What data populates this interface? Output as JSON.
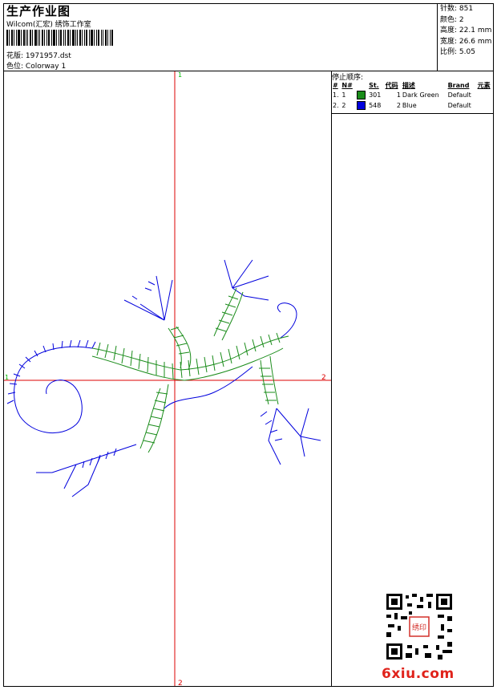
{
  "header": {
    "title": "生产作业图",
    "company": "Wilcom(汇宏) 绣饰工作室",
    "design_label": "花版:",
    "design_value": "1971957.dst",
    "colorway_label": "色位:",
    "colorway_value": "Colorway 1"
  },
  "stats": {
    "stitches_label": "针数:",
    "stitches_value": "851",
    "colors_label": "颜色:",
    "colors_value": "2",
    "height_label": "高度:",
    "height_value": "22.1 mm",
    "width_label": "宽度:",
    "width_value": "26.6 mm",
    "scale_label": "比例:",
    "scale_value": "5.05"
  },
  "stop_sequence": {
    "title": "停止顺序:",
    "headers": [
      "#",
      "N#",
      "St.",
      "代码",
      "描述",
      "Brand",
      "元素"
    ],
    "rows": [
      {
        "index": "1.",
        "n": "1",
        "color": "#1a8c1a",
        "st": "301",
        "code": "1",
        "desc": "Dark Green",
        "brand": "Default",
        "element": ""
      },
      {
        "index": "2.",
        "n": "2",
        "color": "#0000dd",
        "st": "548",
        "code": "2",
        "desc": "Blue",
        "brand": "Default",
        "element": ""
      }
    ]
  },
  "axes": {
    "top_label": "1",
    "bottom_label": "2",
    "left_label": "1",
    "right_label": "2",
    "axis_color": "#dd0000",
    "start_marker_color": "#00bb00"
  },
  "watermark": {
    "text": "6xiu.com",
    "stamp_text": "绣印"
  },
  "colors": {
    "green": "#1a8c1a",
    "blue": "#0000dd"
  }
}
